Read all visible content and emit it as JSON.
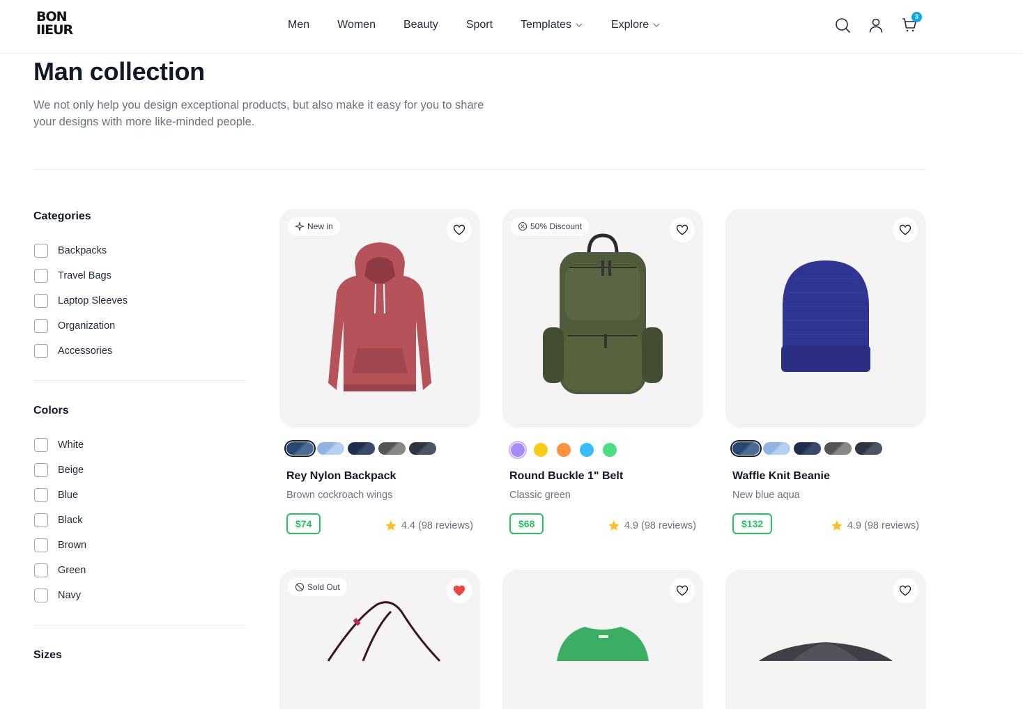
{
  "header": {
    "logo_line1": "BON",
    "logo_line2": "IIEUR",
    "nav": [
      {
        "label": "Men",
        "has_dropdown": false
      },
      {
        "label": "Women",
        "has_dropdown": false
      },
      {
        "label": "Beauty",
        "has_dropdown": false
      },
      {
        "label": "Sport",
        "has_dropdown": false
      },
      {
        "label": "Templates",
        "has_dropdown": true
      },
      {
        "label": "Explore",
        "has_dropdown": true
      }
    ],
    "cart_count": "3",
    "icons": [
      "search-icon",
      "user-icon",
      "cart-icon"
    ],
    "accent_color": "#0ea5e9"
  },
  "page": {
    "title": "Man collection",
    "subtitle": "We not only help you design exceptional products, but also make it easy for you to share your designs with more like-minded people."
  },
  "sidebar": {
    "categories_heading": "Categories",
    "categories": [
      "Backpacks",
      "Travel Bags",
      "Laptop Sleeves",
      "Organization",
      "Accessories"
    ],
    "colors_heading": "Colors",
    "colors": [
      "White",
      "Beige",
      "Blue",
      "Black",
      "Brown",
      "Green",
      "Navy"
    ],
    "sizes_heading": "Sizes"
  },
  "products": [
    {
      "badge": "New in",
      "badge_icon": "sparkles-icon",
      "name": "Rey Nylon Backpack",
      "variant": "Brown cockroach wings",
      "price": "$74",
      "rating": "4.4 (98 reviews)",
      "liked": false,
      "swatch_type": "pill"
    },
    {
      "badge": "50% Discount",
      "badge_icon": "discount-icon",
      "name": "Round Buckle 1\" Belt",
      "variant": "Classic green",
      "price": "$68",
      "rating": "4.9 (98 reviews)",
      "liked": false,
      "swatch_type": "dot",
      "swatch_colors": [
        "#a78bfa",
        "#facc15",
        "#fb923c",
        "#38bdf8",
        "#4ade80"
      ]
    },
    {
      "badge": "",
      "name": "Waffle Knit Beanie",
      "variant": "New blue aqua",
      "price": "$132",
      "rating": "4.9 (98 reviews)",
      "liked": false,
      "swatch_type": "pill"
    },
    {
      "badge": "Sold Out",
      "badge_icon": "no-entry-icon",
      "liked": true
    },
    {
      "badge": "",
      "liked": false
    },
    {
      "badge": "",
      "liked": false
    }
  ],
  "colors": {
    "price_green": "#22c55e",
    "star": "#fbbf24",
    "heart_red": "#ef4444"
  }
}
